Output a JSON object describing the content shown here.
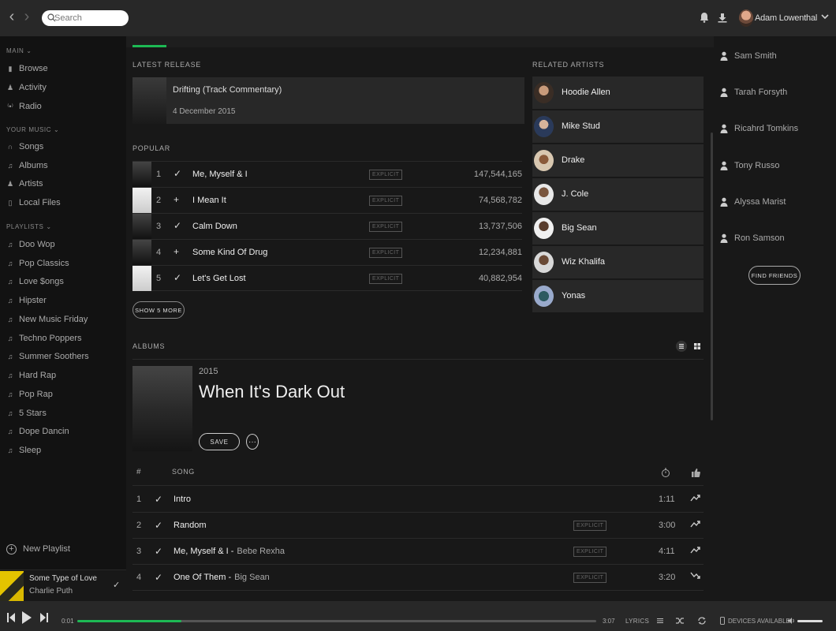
{
  "search": {
    "placeholder": "Search"
  },
  "user": {
    "name": "Adam Lowenthal"
  },
  "sidebar": {
    "main_title": "MAIN",
    "main_items": [
      "Browse",
      "Activity",
      "Radio"
    ],
    "your_music_title": "YOUR MUSIC",
    "your_music_items": [
      "Songs",
      "Albums",
      "Artists",
      "Local Files"
    ],
    "playlists_title": "PLAYLISTS",
    "playlists": [
      "Doo Wop",
      "Pop Classics",
      "Love $ongs",
      "Hipster",
      "New Music Friday",
      "Techno Poppers",
      "Summer Soothers",
      "Hard Rap",
      "Pop Rap",
      "5 Stars",
      "Dope Dancin",
      "Sleep"
    ],
    "new_playlist": "New Playlist"
  },
  "now_playing": {
    "title": "Some Type of Love",
    "artist": "Charlie Puth"
  },
  "latest_release": {
    "heading": "LATEST RELEASE",
    "title": "Drifting (Track Commentary)",
    "date": "4 December 2015"
  },
  "popular": {
    "heading": "POPULAR",
    "explicit_label": "EXPLICIT",
    "rows": [
      {
        "num": "1",
        "action": "✓",
        "name": "Me, Myself & I",
        "plays": "147,544,165"
      },
      {
        "num": "2",
        "action": "+",
        "name": "I Mean It",
        "plays": "74,568,782"
      },
      {
        "num": "3",
        "action": "✓",
        "name": "Calm Down",
        "plays": "13,737,506"
      },
      {
        "num": "4",
        "action": "+",
        "name": "Some Kind Of Drug",
        "plays": "12,234,881"
      },
      {
        "num": "5",
        "action": "✓",
        "name": "Let's Get Lost",
        "plays": "40,882,954"
      }
    ],
    "show_more": "SHOW 5 MORE"
  },
  "related": {
    "heading": "RELATED ARTISTS",
    "artists": [
      "Hoodie Allen",
      "Mike Stud",
      "Drake",
      "J. Cole",
      "Big Sean",
      "Wiz Khalifa",
      "Yonas"
    ]
  },
  "albums": {
    "heading": "ALBUMS",
    "year": "2015",
    "title": "When It's Dark Out",
    "save": "SAVE",
    "more": "···",
    "col_hash": "#",
    "col_song": "SONG",
    "explicit_label": "EXPLICIT",
    "tracks": [
      {
        "num": "1",
        "name": "Intro",
        "feat": "",
        "duration": "1:11",
        "trend": "up"
      },
      {
        "num": "2",
        "name": "Random",
        "feat": "",
        "duration": "3:00",
        "trend": "up"
      },
      {
        "num": "3",
        "name": "Me, Myself & I -",
        "feat": "Bebe Rexha",
        "duration": "4:11",
        "trend": "up"
      },
      {
        "num": "4",
        "name": "One Of Them -",
        "feat": "Big Sean",
        "duration": "3:20",
        "trend": "down"
      }
    ]
  },
  "friends": {
    "list": [
      "Sam Smith",
      "Tarah Forsyth",
      "Ricahrd Tomkins",
      "Tony Russo",
      "Alyssa Marist",
      "Ron Samson"
    ],
    "find_button": "FIND FRIENDS"
  },
  "player": {
    "elapsed": "0:01",
    "total": "3:07",
    "progress_fraction": 0.2,
    "lyrics": "LYRICS",
    "devices": "DEVICES AVAILABLE",
    "volume_fraction": 1.0
  },
  "colors": {
    "accent": "#1db954",
    "background": "#181818",
    "sidebar": "#121212",
    "bar": "#282828"
  }
}
